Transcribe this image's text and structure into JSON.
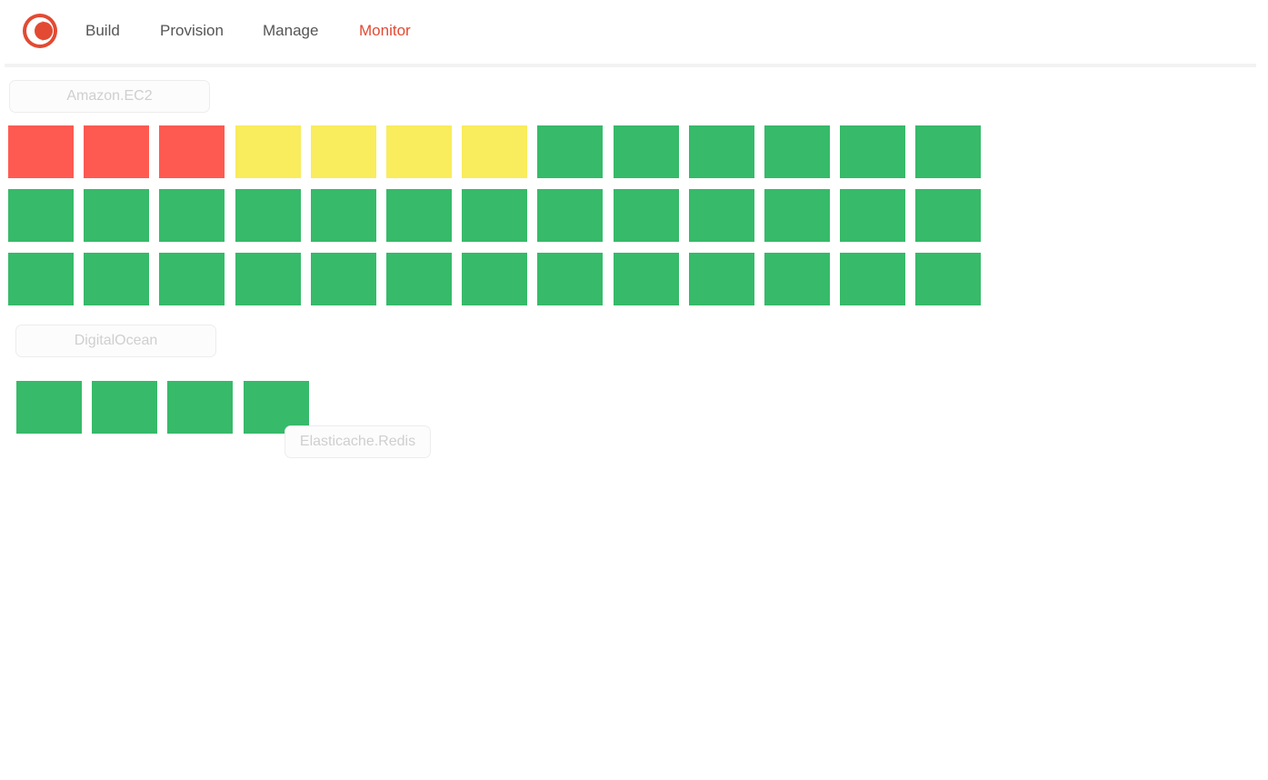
{
  "colors": {
    "brand": "#e24a33",
    "critical": "#ff5a52",
    "warning": "#f9ec5d",
    "ok": "#37ba6a",
    "nav_text": "#555555",
    "label_text": "#cfcfcf"
  },
  "nav": {
    "logo_icon": "logo-icon",
    "items": [
      {
        "label": "Build"
      },
      {
        "label": "Provision"
      },
      {
        "label": "Manage"
      },
      {
        "label": "Monitor",
        "active": true
      }
    ]
  },
  "groups": [
    {
      "label": "Amazon.EC2",
      "statuses": [
        "critical",
        "critical",
        "critical",
        "warning",
        "warning",
        "warning",
        "warning",
        "ok",
        "ok",
        "ok",
        "ok",
        "ok",
        "ok",
        "ok",
        "ok",
        "ok",
        "ok",
        "ok",
        "ok",
        "ok",
        "ok",
        "ok",
        "ok",
        "ok",
        "ok",
        "ok",
        "ok",
        "ok",
        "ok",
        "ok",
        "ok",
        "ok",
        "ok",
        "ok",
        "ok",
        "ok",
        "ok",
        "ok",
        "ok"
      ]
    },
    {
      "label": "DigitalOcean",
      "statuses": [
        "ok",
        "ok",
        "ok",
        "ok"
      ]
    },
    {
      "label": "Elasticache.Redis",
      "statuses": []
    }
  ]
}
